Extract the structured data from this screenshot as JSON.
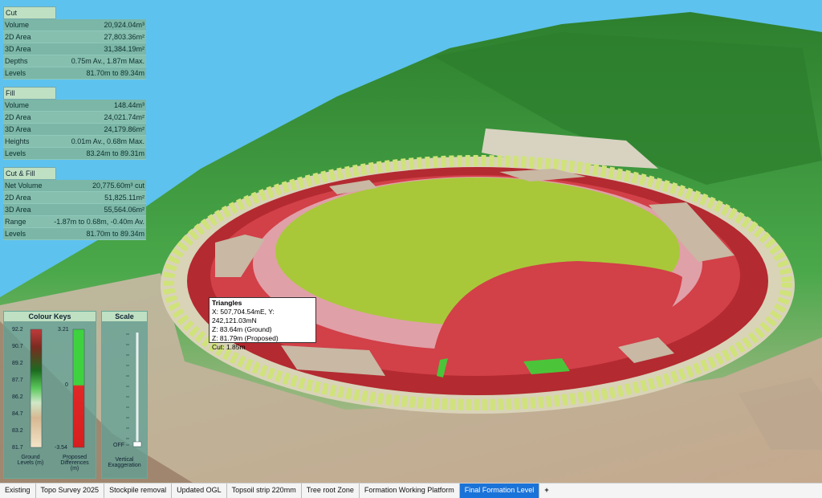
{
  "cut": {
    "title": "Cut",
    "rows": [
      {
        "label": "Volume",
        "value": "20,924.04m³"
      },
      {
        "label": "2D Area",
        "value": "27,803.36m²"
      },
      {
        "label": "3D Area",
        "value": "31,384.19m²"
      },
      {
        "label": "Depths",
        "value": "0.75m Av., 1.87m Max."
      },
      {
        "label": "Levels",
        "value": "81.70m to 89.34m"
      }
    ]
  },
  "fill": {
    "title": "Fill",
    "rows": [
      {
        "label": "Volume",
        "value": "148.44m³"
      },
      {
        "label": "2D Area",
        "value": "24,021.74m²"
      },
      {
        "label": "3D Area",
        "value": "24,179.86m²"
      },
      {
        "label": "Heights",
        "value": "0.01m Av., 0.68m Max."
      },
      {
        "label": "Levels",
        "value": "83.24m to 89.31m"
      }
    ]
  },
  "cutfill": {
    "title": "Cut & Fill",
    "rows": [
      {
        "label": "Net Volume",
        "value": "20,775.60m³ cut"
      },
      {
        "label": "2D Area",
        "value": "51,825.11m²"
      },
      {
        "label": "3D Area",
        "value": "55,564.06m²"
      },
      {
        "label": "Range",
        "value": "-1.87m to 0.68m, -0.40m Av."
      },
      {
        "label": "Levels",
        "value": "81.70m to 89.34m"
      }
    ]
  },
  "colour_keys": {
    "title": "Colour Keys",
    "ground_ticks": [
      "92.2",
      "90.7",
      "89.2",
      "87.7",
      "86.2",
      "84.7",
      "83.2",
      "81.7"
    ],
    "diff_ticks": [
      "3.21",
      "0",
      "-3.54"
    ],
    "ground_caption_1": "Ground",
    "ground_caption_2": "Levels (m)",
    "diff_caption_1": "Proposed",
    "diff_caption_2": "Differences",
    "diff_caption_3": "(m)"
  },
  "scale": {
    "title": "Scale",
    "value_label": "OFF",
    "caption_1": "Vertical",
    "caption_2": "Exaggeration"
  },
  "tooltip": {
    "title": "Triangles",
    "line1": "X: 507,704.54mE, Y: 242,121.03mN",
    "line2": "Z: 83.64m (Ground)",
    "line3": "Z: 81.79m (Proposed)",
    "line4": "Cut: 1.85m"
  },
  "tabs": [
    {
      "label": "Existing",
      "active": false
    },
    {
      "label": "Topo Survey 2025",
      "active": false
    },
    {
      "label": "Stockpile removal",
      "active": false
    },
    {
      "label": "Updated OGL",
      "active": false
    },
    {
      "label": "Topsoil strip 220mm",
      "active": false
    },
    {
      "label": "Tree root Zone",
      "active": false
    },
    {
      "label": "Formation Working Platform",
      "active": false
    },
    {
      "label": "Final Formation Level",
      "active": true
    }
  ],
  "add_tab_label": "+",
  "colors": {
    "sky": "#5ec2ee",
    "terrain_green": "#2f8a2f",
    "cut_red": "#c8343a",
    "fill_green": "#4cc43a",
    "pitch": "#a8c83a",
    "active_tab": "#1a73d8"
  }
}
